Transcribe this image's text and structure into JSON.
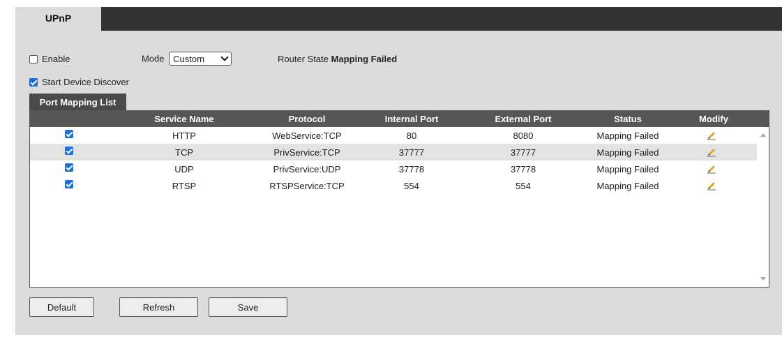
{
  "header": {
    "tab_label": "UPnP"
  },
  "settings": {
    "enable_label": "Enable",
    "enable_checked": false,
    "mode_label": "Mode",
    "mode_value": "Custom",
    "router_state_label": "Router State",
    "router_state_value": "Mapping Failed",
    "start_discover_label": "Start Device Discover",
    "start_discover_checked": true
  },
  "port_mapping": {
    "tab_label": "Port Mapping List",
    "columns": {
      "service_name": "Service Name",
      "protocol": "Protocol",
      "internal_port": "Internal Port",
      "external_port": "External Port",
      "status": "Status",
      "modify": "Modify"
    },
    "rows": [
      {
        "checked": true,
        "service_name": "HTTP",
        "protocol": "WebService:TCP",
        "internal_port": "80",
        "external_port": "8080",
        "status": "Mapping Failed"
      },
      {
        "checked": true,
        "service_name": "TCP",
        "protocol": "PrivService:TCP",
        "internal_port": "37777",
        "external_port": "37777",
        "status": "Mapping Failed"
      },
      {
        "checked": true,
        "service_name": "UDP",
        "protocol": "PrivService:UDP",
        "internal_port": "37778",
        "external_port": "37778",
        "status": "Mapping Failed"
      },
      {
        "checked": true,
        "service_name": "RTSP",
        "protocol": "RTSPService:TCP",
        "internal_port": "554",
        "external_port": "554",
        "status": "Mapping Failed"
      }
    ],
    "modify_icon": "pencil-icon"
  },
  "buttons": {
    "default_label": "Default",
    "refresh_label": "Refresh",
    "save_label": "Save"
  },
  "colors": {
    "accent": "#1f6fd8",
    "header_bar": "#333333",
    "pencil": "#e8a020"
  }
}
